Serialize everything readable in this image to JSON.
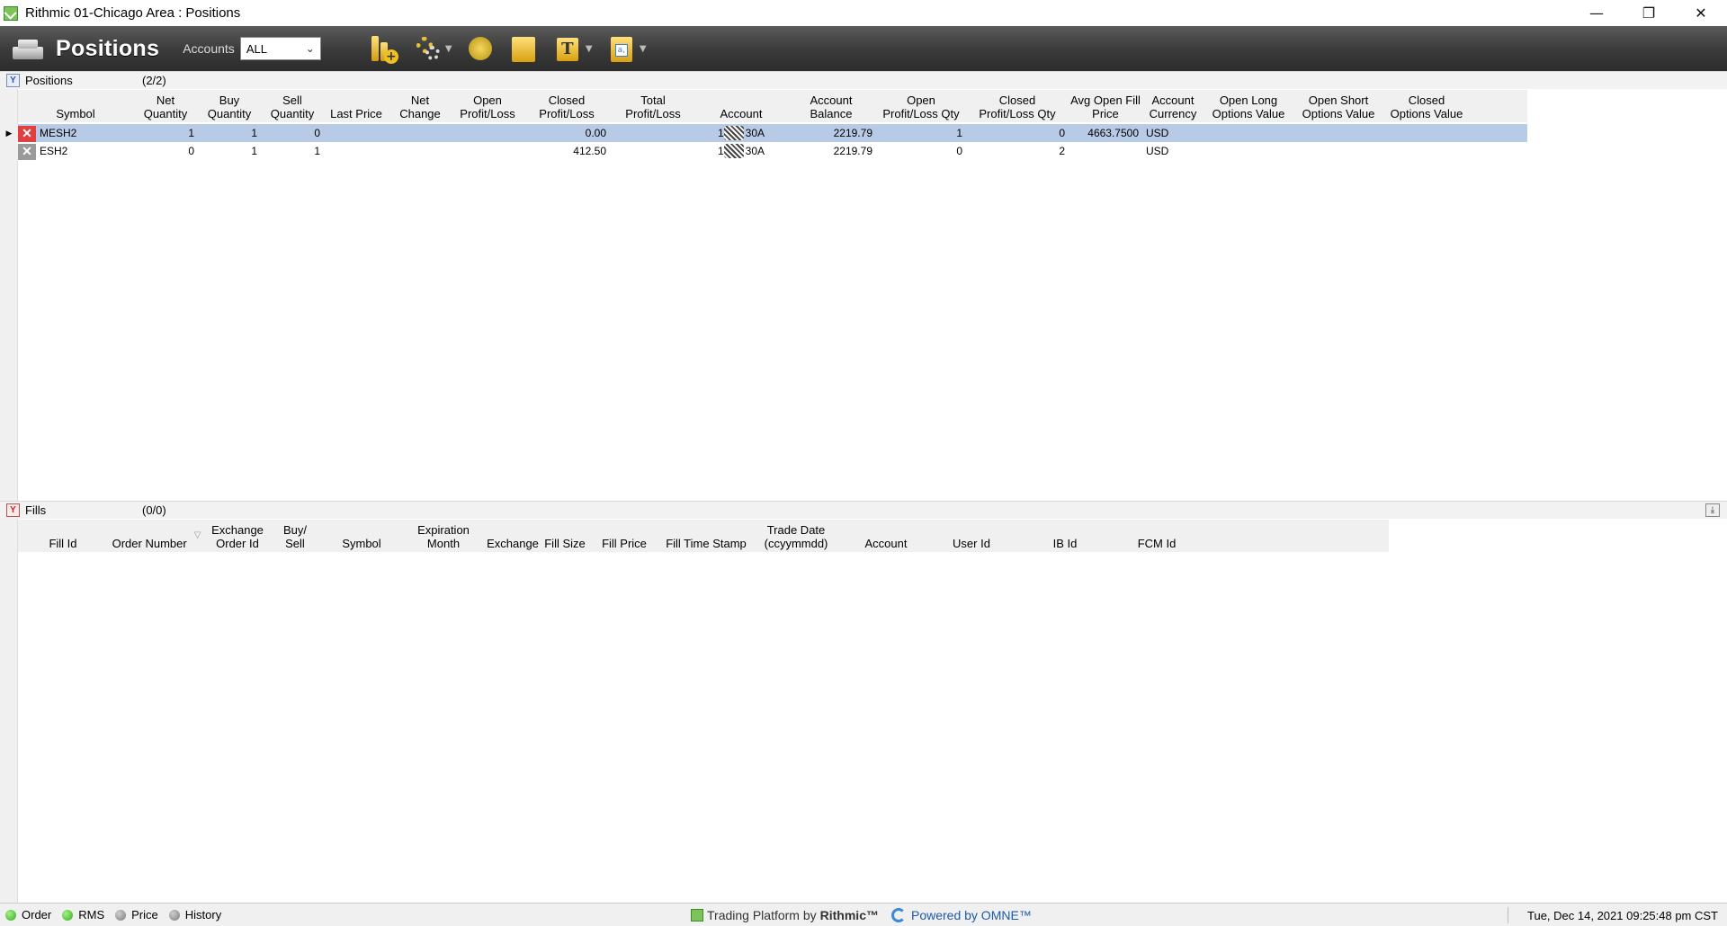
{
  "window": {
    "title": "Rithmic 01-Chicago Area : Positions",
    "minimize": "—",
    "restore": "❐",
    "close": "✕"
  },
  "toolbar": {
    "title": "Positions",
    "accounts_label": "Accounts",
    "accounts_value": "ALL",
    "icons": [
      "new-order-icon",
      "order-settings-icon",
      "money-icon",
      "folder-icon",
      "text-icon",
      "clipboard-icon"
    ]
  },
  "positions": {
    "title": "Positions",
    "count": "(2/2)",
    "columns": [
      "Symbol",
      "Net\nQuantity",
      "Buy\nQuantity",
      "Sell\nQuantity",
      "Last Price",
      "Net\nChange",
      "Open\nProfit/Loss",
      "Closed\nProfit/Loss",
      "Total\nProfit/Loss",
      "Account",
      "Account\nBalance",
      "Open\nProfit/Loss Qty",
      "Closed\nProfit/Loss Qty",
      "Avg Open Fill\nPrice",
      "Account\nCurrency",
      "Open Long\nOptions Value",
      "Open Short\nOptions Value",
      "Closed\nOptions Value"
    ],
    "rows": [
      {
        "selected": true,
        "symbol": "MESH2",
        "net_qty": "1",
        "buy_qty": "1",
        "sell_qty": "0",
        "last_price": "",
        "net_change": "",
        "open_pl": "",
        "closed_pl": "0.00",
        "total_pl": "",
        "account_prefix": "1",
        "account_suffix": "30A",
        "account_balance": "2219.79",
        "open_pl_qty": "1",
        "closed_pl_qty": "0",
        "avg_open_fill": "4663.7500",
        "currency": "USD",
        "open_long_opt": "",
        "open_short_opt": "",
        "closed_opt": ""
      },
      {
        "selected": false,
        "symbol": "ESH2",
        "net_qty": "0",
        "buy_qty": "1",
        "sell_qty": "1",
        "last_price": "",
        "net_change": "",
        "open_pl": "",
        "closed_pl": "412.50",
        "total_pl": "",
        "account_prefix": "1",
        "account_suffix": "30A",
        "account_balance": "2219.79",
        "open_pl_qty": "0",
        "closed_pl_qty": "2",
        "avg_open_fill": "",
        "currency": "USD",
        "open_long_opt": "",
        "open_short_opt": "",
        "closed_opt": ""
      }
    ]
  },
  "fills": {
    "title": "Fills",
    "count": "(0/0)",
    "sort_indicator": "▽",
    "columns": [
      "Fill Id",
      "Order Number",
      "Exchange\nOrder Id",
      "Buy/\nSell",
      "Symbol",
      "Expiration\nMonth",
      "Exchange",
      "Fill Size",
      "Fill Price",
      "Fill Time Stamp",
      "Trade Date\n(ccyymmdd)",
      "Account",
      "User Id",
      "IB Id",
      "FCM Id"
    ]
  },
  "statusbar": {
    "items": [
      {
        "label": "Order",
        "status": "green"
      },
      {
        "label": "RMS",
        "status": "green"
      },
      {
        "label": "Price",
        "status": "grey"
      },
      {
        "label": "History",
        "status": "grey"
      }
    ],
    "platform_text": "Trading Platform by",
    "platform_brand": "Rithmic™",
    "powered_text": "Powered by OMNE™",
    "datetime": "Tue, Dec 14, 2021 09:25:48 pm CST"
  }
}
